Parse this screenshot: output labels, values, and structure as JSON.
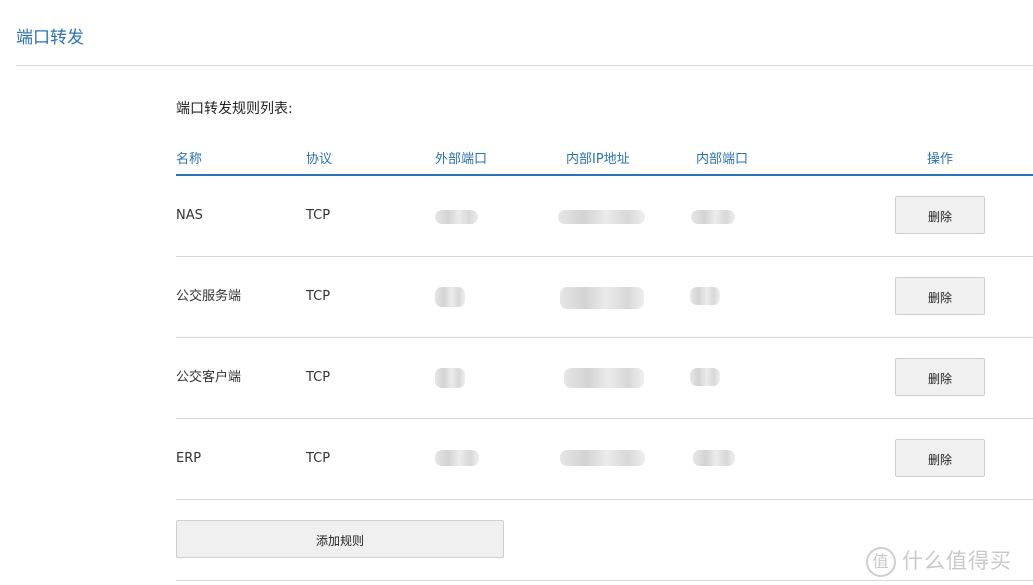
{
  "page": {
    "title": "端口转发"
  },
  "rules": {
    "section_title": "端口转发规则列表:",
    "headers": {
      "name": "名称",
      "protocol": "协议",
      "external_port": "外部端口",
      "internal_ip": "内部IP地址",
      "internal_port": "内部端口",
      "actions": "操作"
    },
    "rows": [
      {
        "name": "NAS",
        "protocol": "TCP",
        "delete_label": "删除"
      },
      {
        "name": "公交服务端",
        "protocol": "TCP",
        "delete_label": "删除"
      },
      {
        "name": "公交客户端",
        "protocol": "TCP",
        "delete_label": "删除"
      },
      {
        "name": "ERP",
        "protocol": "TCP",
        "delete_label": "删除"
      }
    ],
    "add_label": "添加规则"
  },
  "watermark": {
    "logo_char": "值",
    "text": "什么值得买"
  },
  "colors": {
    "accent": "#2a72b8",
    "button_bg": "#f0f0f0",
    "divider": "#d6d6d6"
  }
}
